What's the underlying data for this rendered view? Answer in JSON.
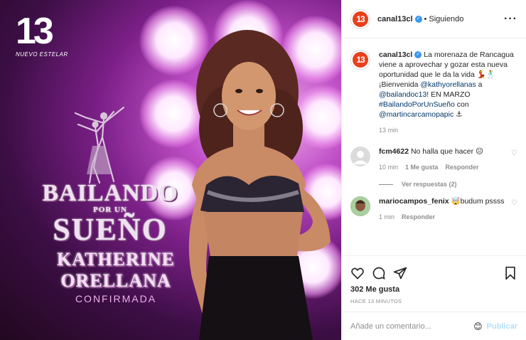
{
  "media": {
    "logo_number": "13",
    "logo_subtitle": "NUEVO ESTELAR",
    "show_title_line1": "BAILANDO",
    "show_title_line2": "POR UN",
    "show_title_line3": "SUEÑO",
    "name_line1": "KATHERINE",
    "name_line2": "ORELLANA",
    "status": "CONFIRMADA"
  },
  "header": {
    "username": "canal13cl",
    "separator": "•",
    "follow_status": "Siguiendo",
    "more_icon": "···"
  },
  "caption": {
    "username": "canal13cl",
    "text_before": "La morenaza de Rancagua viene a aprovechar y gozar esta nueva oportunidad que le da la vida 💃🕺 ¡Bienvenida ",
    "mention1": "@kathyorellanas",
    "text_mid": " a ",
    "mention2": "@bailandoc13",
    "text_mid2": "! EN MARZO ",
    "hashtag": "#BailandoPorUnSueño",
    "text_mid3": " con ",
    "mention3": "@martincarcamopapic",
    "text_end": " ⚓",
    "time": "13 min"
  },
  "comments": [
    {
      "username": "fcm4622",
      "text": "No halla que hacer 😐",
      "time": "10 min",
      "likes": "1 Me gusta",
      "reply": "Responder"
    },
    {
      "username": "mariocampos_fenix",
      "text": "🤯budum pssss",
      "time": "1 min",
      "reply": "Responder"
    }
  ],
  "view_replies": "Ver respuestas (2)",
  "likes_count": "302 Me gusta",
  "posted_ago": "HACE 13 MINUTOS",
  "add_comment": {
    "placeholder": "Añade un comentario...",
    "emoji_icon": "😊",
    "publish_label": "Publicar"
  },
  "colors": {
    "brand_orange": "#e8401c",
    "link_blue": "#00376b",
    "verified_blue": "#3897f0",
    "publish_disabled": "#b2dffc"
  }
}
